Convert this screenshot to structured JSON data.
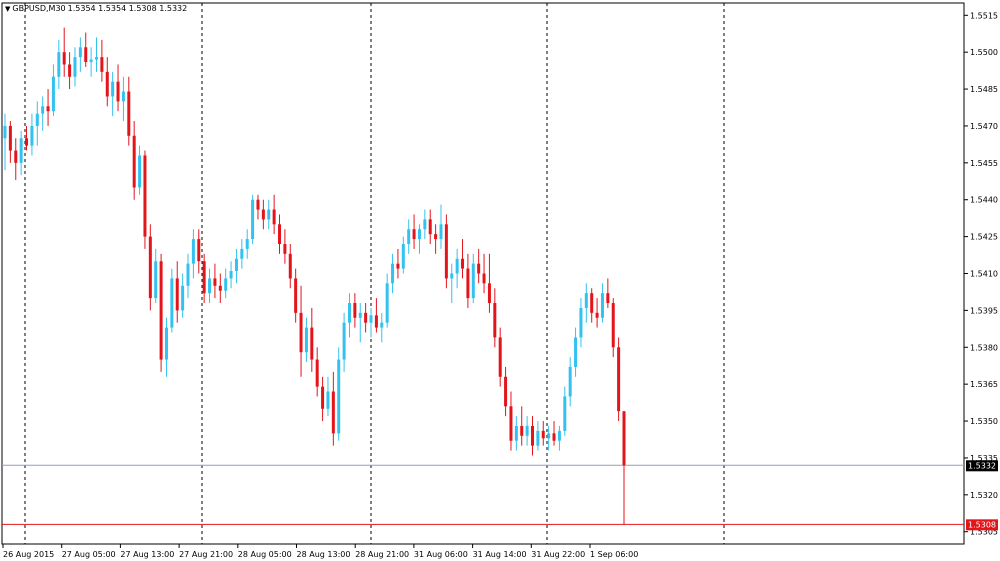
{
  "header": {
    "menu_icon": "triangle-down-icon",
    "symbol": "GBPUSD,M30",
    "ohlc": "1.5354 1.5354 1.5308 1.5332"
  },
  "colors": {
    "bull": "#33c2f0",
    "bear": "#e4141b",
    "grid": "#000000",
    "bid_line": "#8aa1bd",
    "ask_line": "#e4141b",
    "axis": "#000000"
  },
  "chart_data": {
    "type": "candlestick",
    "symbol": "GBPUSD",
    "timeframe": "M30",
    "ylim": [
      1.53,
      1.552
    ],
    "y_ticks": [
      "1.5515",
      "1.5500",
      "1.5485",
      "1.5470",
      "1.5455",
      "1.5440",
      "1.5425",
      "1.5410",
      "1.5395",
      "1.5380",
      "1.5365",
      "1.5350",
      "1.5335",
      "1.5320",
      "1.5305"
    ],
    "x_ticks": [
      "26 Aug 2015",
      "27 Aug 05:00",
      "27 Aug 13:00",
      "27 Aug 21:00",
      "28 Aug 05:00",
      "28 Aug 13:00",
      "28 Aug 21:00",
      "31 Aug 06:00",
      "31 Aug 14:00",
      "31 Aug 22:00",
      "1 Sep 06:00"
    ],
    "bid_price": 1.5332,
    "bid_label": "1.5332",
    "ask_price": 1.5308,
    "ask_label": "1.5308",
    "period_separators": 6,
    "ohlc": [
      [
        1.5465,
        1.5475,
        1.5452,
        1.547
      ],
      [
        1.547,
        1.5472,
        1.5455,
        1.546
      ],
      [
        1.546,
        1.5465,
        1.5448,
        1.5455
      ],
      [
        1.5455,
        1.5468,
        1.545,
        1.5465
      ],
      [
        1.5465,
        1.547,
        1.546,
        1.5462
      ],
      [
        1.5462,
        1.5475,
        1.5458,
        1.547
      ],
      [
        1.547,
        1.548,
        1.5462,
        1.5475
      ],
      [
        1.5475,
        1.5482,
        1.5468,
        1.5478
      ],
      [
        1.5478,
        1.5485,
        1.547,
        1.5476
      ],
      [
        1.5476,
        1.5495,
        1.5474,
        1.549
      ],
      [
        1.549,
        1.5505,
        1.5485,
        1.55
      ],
      [
        1.55,
        1.551,
        1.549,
        1.5495
      ],
      [
        1.5495,
        1.55,
        1.5485,
        1.549
      ],
      [
        1.549,
        1.5502,
        1.5486,
        1.5498
      ],
      [
        1.5498,
        1.5506,
        1.5492,
        1.5502
      ],
      [
        1.5502,
        1.5508,
        1.5494,
        1.5496
      ],
      [
        1.5496,
        1.5502,
        1.549,
        1.5497
      ],
      [
        1.5497,
        1.5506,
        1.5492,
        1.5498
      ],
      [
        1.5498,
        1.5505,
        1.5488,
        1.5492
      ],
      [
        1.5492,
        1.5498,
        1.5478,
        1.5482
      ],
      [
        1.5482,
        1.5492,
        1.5474,
        1.5488
      ],
      [
        1.5488,
        1.5495,
        1.5476,
        1.548
      ],
      [
        1.548,
        1.549,
        1.5472,
        1.5484
      ],
      [
        1.5484,
        1.549,
        1.5462,
        1.5466
      ],
      [
        1.5466,
        1.5472,
        1.544,
        1.5445
      ],
      [
        1.5445,
        1.5462,
        1.5442,
        1.5458
      ],
      [
        1.5458,
        1.546,
        1.542,
        1.5425
      ],
      [
        1.5425,
        1.543,
        1.5395,
        1.54
      ],
      [
        1.54,
        1.542,
        1.5398,
        1.5415
      ],
      [
        1.5415,
        1.5418,
        1.537,
        1.5375
      ],
      [
        1.5375,
        1.5392,
        1.5368,
        1.5388
      ],
      [
        1.5388,
        1.5412,
        1.5386,
        1.5408
      ],
      [
        1.5408,
        1.5415,
        1.539,
        1.5395
      ],
      [
        1.5395,
        1.541,
        1.5392,
        1.5405
      ],
      [
        1.5405,
        1.5418,
        1.54,
        1.5414
      ],
      [
        1.5414,
        1.5428,
        1.5408,
        1.5424
      ],
      [
        1.5424,
        1.5428,
        1.541,
        1.5415
      ],
      [
        1.5415,
        1.5418,
        1.5398,
        1.5402
      ],
      [
        1.5402,
        1.5412,
        1.5398,
        1.5408
      ],
      [
        1.5408,
        1.5414,
        1.54,
        1.5405
      ],
      [
        1.5405,
        1.541,
        1.5398,
        1.5403
      ],
      [
        1.5403,
        1.5412,
        1.54,
        1.5408
      ],
      [
        1.5408,
        1.5415,
        1.5404,
        1.5411
      ],
      [
        1.5411,
        1.542,
        1.5406,
        1.5416
      ],
      [
        1.5416,
        1.5424,
        1.5412,
        1.542
      ],
      [
        1.542,
        1.5428,
        1.5416,
        1.5424
      ],
      [
        1.5424,
        1.5442,
        1.5422,
        1.544
      ],
      [
        1.544,
        1.5442,
        1.5432,
        1.5436
      ],
      [
        1.5436,
        1.544,
        1.5428,
        1.5432
      ],
      [
        1.5432,
        1.544,
        1.5428,
        1.5436
      ],
      [
        1.5436,
        1.5442,
        1.5426,
        1.543
      ],
      [
        1.543,
        1.5434,
        1.5418,
        1.5422
      ],
      [
        1.5422,
        1.5428,
        1.5414,
        1.5418
      ],
      [
        1.5418,
        1.5422,
        1.5404,
        1.5408
      ],
      [
        1.5408,
        1.5412,
        1.539,
        1.5394
      ],
      [
        1.5394,
        1.5405,
        1.5368,
        1.5378
      ],
      [
        1.5378,
        1.5392,
        1.5374,
        1.5388
      ],
      [
        1.5388,
        1.5396,
        1.537,
        1.5375
      ],
      [
        1.5375,
        1.538,
        1.536,
        1.5364
      ],
      [
        1.5364,
        1.5368,
        1.535,
        1.5355
      ],
      [
        1.5355,
        1.5368,
        1.5352,
        1.5362
      ],
      [
        1.5362,
        1.537,
        1.534,
        1.5345
      ],
      [
        1.5345,
        1.538,
        1.5342,
        1.5375
      ],
      [
        1.5375,
        1.5394,
        1.537,
        1.539
      ],
      [
        1.539,
        1.5402,
        1.5384,
        1.5398
      ],
      [
        1.5398,
        1.5402,
        1.5388,
        1.5392
      ],
      [
        1.5392,
        1.5398,
        1.5382,
        1.5394
      ],
      [
        1.5394,
        1.5398,
        1.5386,
        1.539
      ],
      [
        1.539,
        1.5396,
        1.5384,
        1.5393
      ],
      [
        1.5393,
        1.54,
        1.5386,
        1.5388
      ],
      [
        1.5388,
        1.5394,
        1.5382,
        1.539
      ],
      [
        1.539,
        1.541,
        1.5388,
        1.5406
      ],
      [
        1.5406,
        1.5418,
        1.5402,
        1.5414
      ],
      [
        1.5414,
        1.542,
        1.5408,
        1.5412
      ],
      [
        1.5412,
        1.5425,
        1.541,
        1.5422
      ],
      [
        1.5422,
        1.5432,
        1.5418,
        1.5428
      ],
      [
        1.5428,
        1.5434,
        1.542,
        1.5424
      ],
      [
        1.5424,
        1.543,
        1.5418,
        1.5428
      ],
      [
        1.5428,
        1.5436,
        1.5424,
        1.5432
      ],
      [
        1.5432,
        1.5436,
        1.5422,
        1.5426
      ],
      [
        1.5426,
        1.543,
        1.5418,
        1.5424
      ],
      [
        1.5424,
        1.5438,
        1.542,
        1.543
      ],
      [
        1.543,
        1.5434,
        1.5404,
        1.5408
      ],
      [
        1.5408,
        1.5414,
        1.5398,
        1.541
      ],
      [
        1.541,
        1.542,
        1.5404,
        1.5416
      ],
      [
        1.5416,
        1.5424,
        1.5408,
        1.5412
      ],
      [
        1.5412,
        1.5418,
        1.5396,
        1.54
      ],
      [
        1.54,
        1.5418,
        1.5398,
        1.5414
      ],
      [
        1.5414,
        1.542,
        1.5406,
        1.541
      ],
      [
        1.541,
        1.5418,
        1.5402,
        1.5406
      ],
      [
        1.5406,
        1.5418,
        1.5394,
        1.5398
      ],
      [
        1.5398,
        1.5404,
        1.538,
        1.5384
      ],
      [
        1.5384,
        1.5388,
        1.5364,
        1.5368
      ],
      [
        1.5368,
        1.5372,
        1.5352,
        1.5356
      ],
      [
        1.5356,
        1.5362,
        1.5338,
        1.5342
      ],
      [
        1.5342,
        1.5352,
        1.5338,
        1.5348
      ],
      [
        1.5348,
        1.5356,
        1.534,
        1.5344
      ],
      [
        1.5344,
        1.5352,
        1.534,
        1.5348
      ],
      [
        1.5348,
        1.5352,
        1.5336,
        1.534
      ],
      [
        1.534,
        1.535,
        1.5338,
        1.5346
      ],
      [
        1.5346,
        1.535,
        1.534,
        1.5343
      ],
      [
        1.5343,
        1.5348,
        1.5338,
        1.5345
      ],
      [
        1.5345,
        1.535,
        1.534,
        1.5342
      ],
      [
        1.5342,
        1.5348,
        1.5338,
        1.5346
      ],
      [
        1.5346,
        1.5364,
        1.5344,
        1.536
      ],
      [
        1.536,
        1.5376,
        1.5356,
        1.5372
      ],
      [
        1.5372,
        1.5388,
        1.5368,
        1.5384
      ],
      [
        1.5384,
        1.54,
        1.538,
        1.5396
      ],
      [
        1.5396,
        1.5406,
        1.539,
        1.5402
      ],
      [
        1.5402,
        1.5404,
        1.539,
        1.5394
      ],
      [
        1.5394,
        1.54,
        1.5388,
        1.5392
      ],
      [
        1.5392,
        1.5406,
        1.539,
        1.5402
      ],
      [
        1.5402,
        1.5408,
        1.5396,
        1.5398
      ],
      [
        1.5398,
        1.54,
        1.5376,
        1.538
      ],
      [
        1.538,
        1.5384,
        1.535,
        1.5354
      ],
      [
        1.5354,
        1.5354,
        1.5308,
        1.5332
      ]
    ]
  }
}
